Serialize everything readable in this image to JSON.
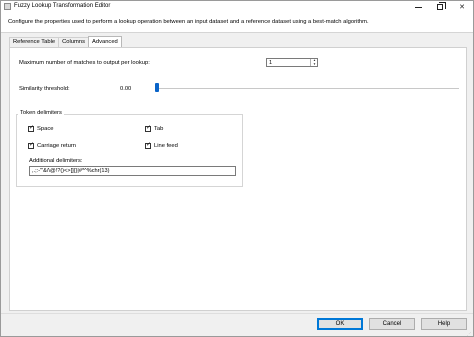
{
  "window": {
    "title": "Fuzzy Lookup Transformation Editor",
    "description": "Configure the properties used to perform a lookup operation between an input dataset and a reference dataset using a best-match algorithm."
  },
  "tabs": [
    {
      "label": "Reference Table",
      "active": false
    },
    {
      "label": "Columns",
      "active": false
    },
    {
      "label": "Advanced",
      "active": true
    }
  ],
  "advanced": {
    "max_matches_label": "Maximum number of matches to output per lookup:",
    "max_matches_value": "1",
    "similarity_label": "Similarity threshold:",
    "similarity_value": "0.00",
    "similarity_fraction": 0.0,
    "token_delimiters": {
      "group_title": "Token delimiters",
      "space": {
        "label": "Space",
        "checked": true
      },
      "tab": {
        "label": "Tab",
        "checked": true
      },
      "carriage_return": {
        "label": "Carriage return",
        "checked": true
      },
      "line_feed": {
        "label": "Line feed",
        "checked": true
      },
      "additional_label": "Additional delimiters:",
      "additional_value": ",.;:-\"'&/\\@!?()<>[]{}|#*^%chr(13)"
    }
  },
  "buttons": {
    "ok": "OK",
    "cancel": "Cancel",
    "help": "Help"
  },
  "icons": {
    "app": "app-icon",
    "minimize": "minimize-icon",
    "maximize": "restore-icon",
    "close": "close-icon",
    "check": "checkmark-icon"
  },
  "colors": {
    "accent": "#0078d7",
    "slider_thumb": "#0a64c8"
  }
}
